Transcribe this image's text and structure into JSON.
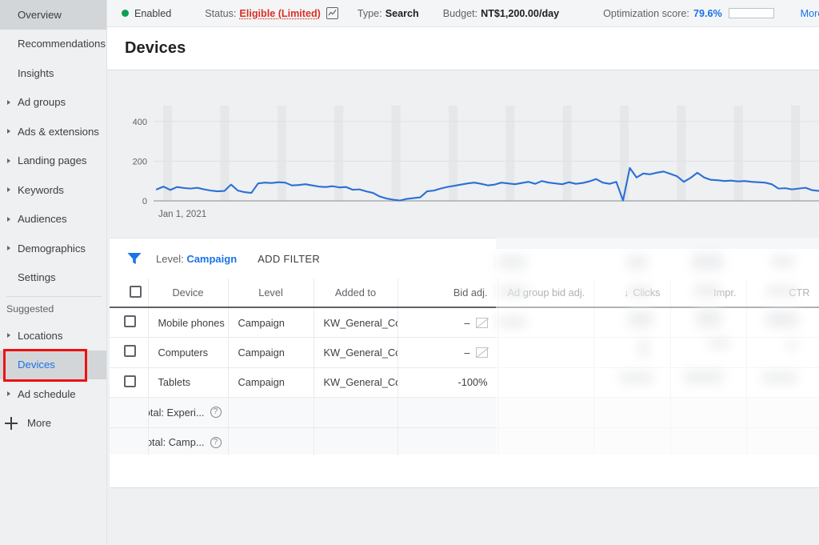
{
  "sidebar": {
    "items": [
      {
        "label": "Overview",
        "expandable": false,
        "state": "hover"
      },
      {
        "label": "Recommendations",
        "expandable": false,
        "state": "normal"
      },
      {
        "label": "Insights",
        "expandable": false,
        "state": "normal"
      },
      {
        "label": "Ad groups",
        "expandable": true,
        "state": "normal"
      },
      {
        "label": "Ads & extensions",
        "expandable": true,
        "state": "normal"
      },
      {
        "label": "Landing pages",
        "expandable": true,
        "state": "normal"
      },
      {
        "label": "Keywords",
        "expandable": true,
        "state": "normal"
      },
      {
        "label": "Audiences",
        "expandable": true,
        "state": "normal"
      },
      {
        "label": "Demographics",
        "expandable": true,
        "state": "normal"
      },
      {
        "label": "Settings",
        "expandable": false,
        "state": "normal"
      }
    ],
    "group_label": "Suggested",
    "suggested_items": [
      {
        "label": "Locations",
        "expandable": true,
        "state": "normal"
      },
      {
        "label": "Devices",
        "expandable": false,
        "state": "active"
      },
      {
        "label": "Ad schedule",
        "expandable": true,
        "state": "normal"
      }
    ],
    "more_label": "More",
    "more_icon": "plus-icon",
    "annotation_color": "#ee1111"
  },
  "statusbar": {
    "enabled_label": "Enabled",
    "enabled_dot_color": "#0f9d58",
    "status_label": "Status:",
    "status_value": "Eligible (Limited)",
    "status_value_color": "#d93025",
    "status_icon": "chart-mini-icon",
    "type_label": "Type:",
    "type_value": "Search",
    "budget_label": "Budget:",
    "budget_value": "NT$1,200.00/day",
    "optimization_label": "Optimization score:",
    "optimization_value": "79.6%",
    "optimization_percent": 79.6,
    "optimization_bar_color": "#1a56db",
    "more_details_label": "More details",
    "more_details_color": "#1a73e8"
  },
  "page": {
    "title": "Devices"
  },
  "filterbar": {
    "funnel_icon": "filter-funnel-icon",
    "funnel_color": "#1a73e8",
    "level_chip_prefix": "Level: ",
    "level_chip_value": "Campaign",
    "add_filter_label": "ADD FILTER"
  },
  "table": {
    "columns": [
      {
        "key": "check",
        "label": ""
      },
      {
        "key": "device",
        "label": "Device"
      },
      {
        "key": "level",
        "label": "Level"
      },
      {
        "key": "added",
        "label": "Added to"
      },
      {
        "key": "bid",
        "label": "Bid adj."
      },
      {
        "key": "agbid",
        "label": "Ad group bid adj."
      },
      {
        "key": "clicks",
        "label": "Clicks",
        "sorted": true,
        "sort_dir": "↓"
      },
      {
        "key": "impr",
        "label": "Impr."
      },
      {
        "key": "ctr",
        "label": "CTR"
      },
      {
        "key": "last",
        "label": ""
      }
    ],
    "rows": [
      {
        "device": "Mobile phones",
        "level": "Campaign",
        "added": "KW_General_Conan",
        "bid": "–",
        "bid_icon": "no-edit-icon"
      },
      {
        "device": "Computers",
        "level": "Campaign",
        "added": "KW_General_Conan",
        "bid": "–",
        "bid_icon": "no-edit-icon"
      },
      {
        "device": "Tablets",
        "level": "Campaign",
        "added": "KW_General_Conan",
        "bid": "-100%",
        "bid_icon": ""
      }
    ],
    "total_rows": [
      {
        "label": "Total: Experi...",
        "help_icon": "help-icon"
      },
      {
        "label": "Total: Camp...",
        "help_icon": "help-icon"
      }
    ]
  },
  "chart_data": {
    "type": "line",
    "title": "",
    "xlabel": "",
    "ylabel": "",
    "ylim": [
      0,
      480
    ],
    "yticks": [
      0,
      200,
      400
    ],
    "ytick_labels": [
      "0",
      "200",
      "400"
    ],
    "xticks": [
      "Jan 1, 2021"
    ],
    "grid": true,
    "line_color": "#2b6fd6",
    "series": [
      {
        "name": "Clicks",
        "values": [
          58,
          72,
          55,
          70,
          65,
          62,
          66,
          58,
          52,
          48,
          50,
          82,
          52,
          44,
          40,
          88,
          92,
          90,
          94,
          92,
          78,
          80,
          84,
          78,
          72,
          70,
          74,
          68,
          70,
          56,
          58,
          48,
          40,
          22,
          12,
          6,
          2,
          10,
          14,
          18,
          48,
          52,
          62,
          70,
          76,
          82,
          88,
          92,
          86,
          78,
          82,
          92,
          88,
          84,
          90,
          96,
          86,
          100,
          92,
          88,
          84,
          94,
          86,
          90,
          98,
          110,
          92,
          86,
          96,
          2,
          166,
          118,
          138,
          134,
          142,
          148,
          136,
          124,
          96,
          116,
          142,
          118,
          106,
          104,
          100,
          102,
          98,
          100,
          96,
          94,
          92,
          84,
          62,
          64,
          58,
          62,
          66,
          54,
          50
        ]
      }
    ]
  }
}
